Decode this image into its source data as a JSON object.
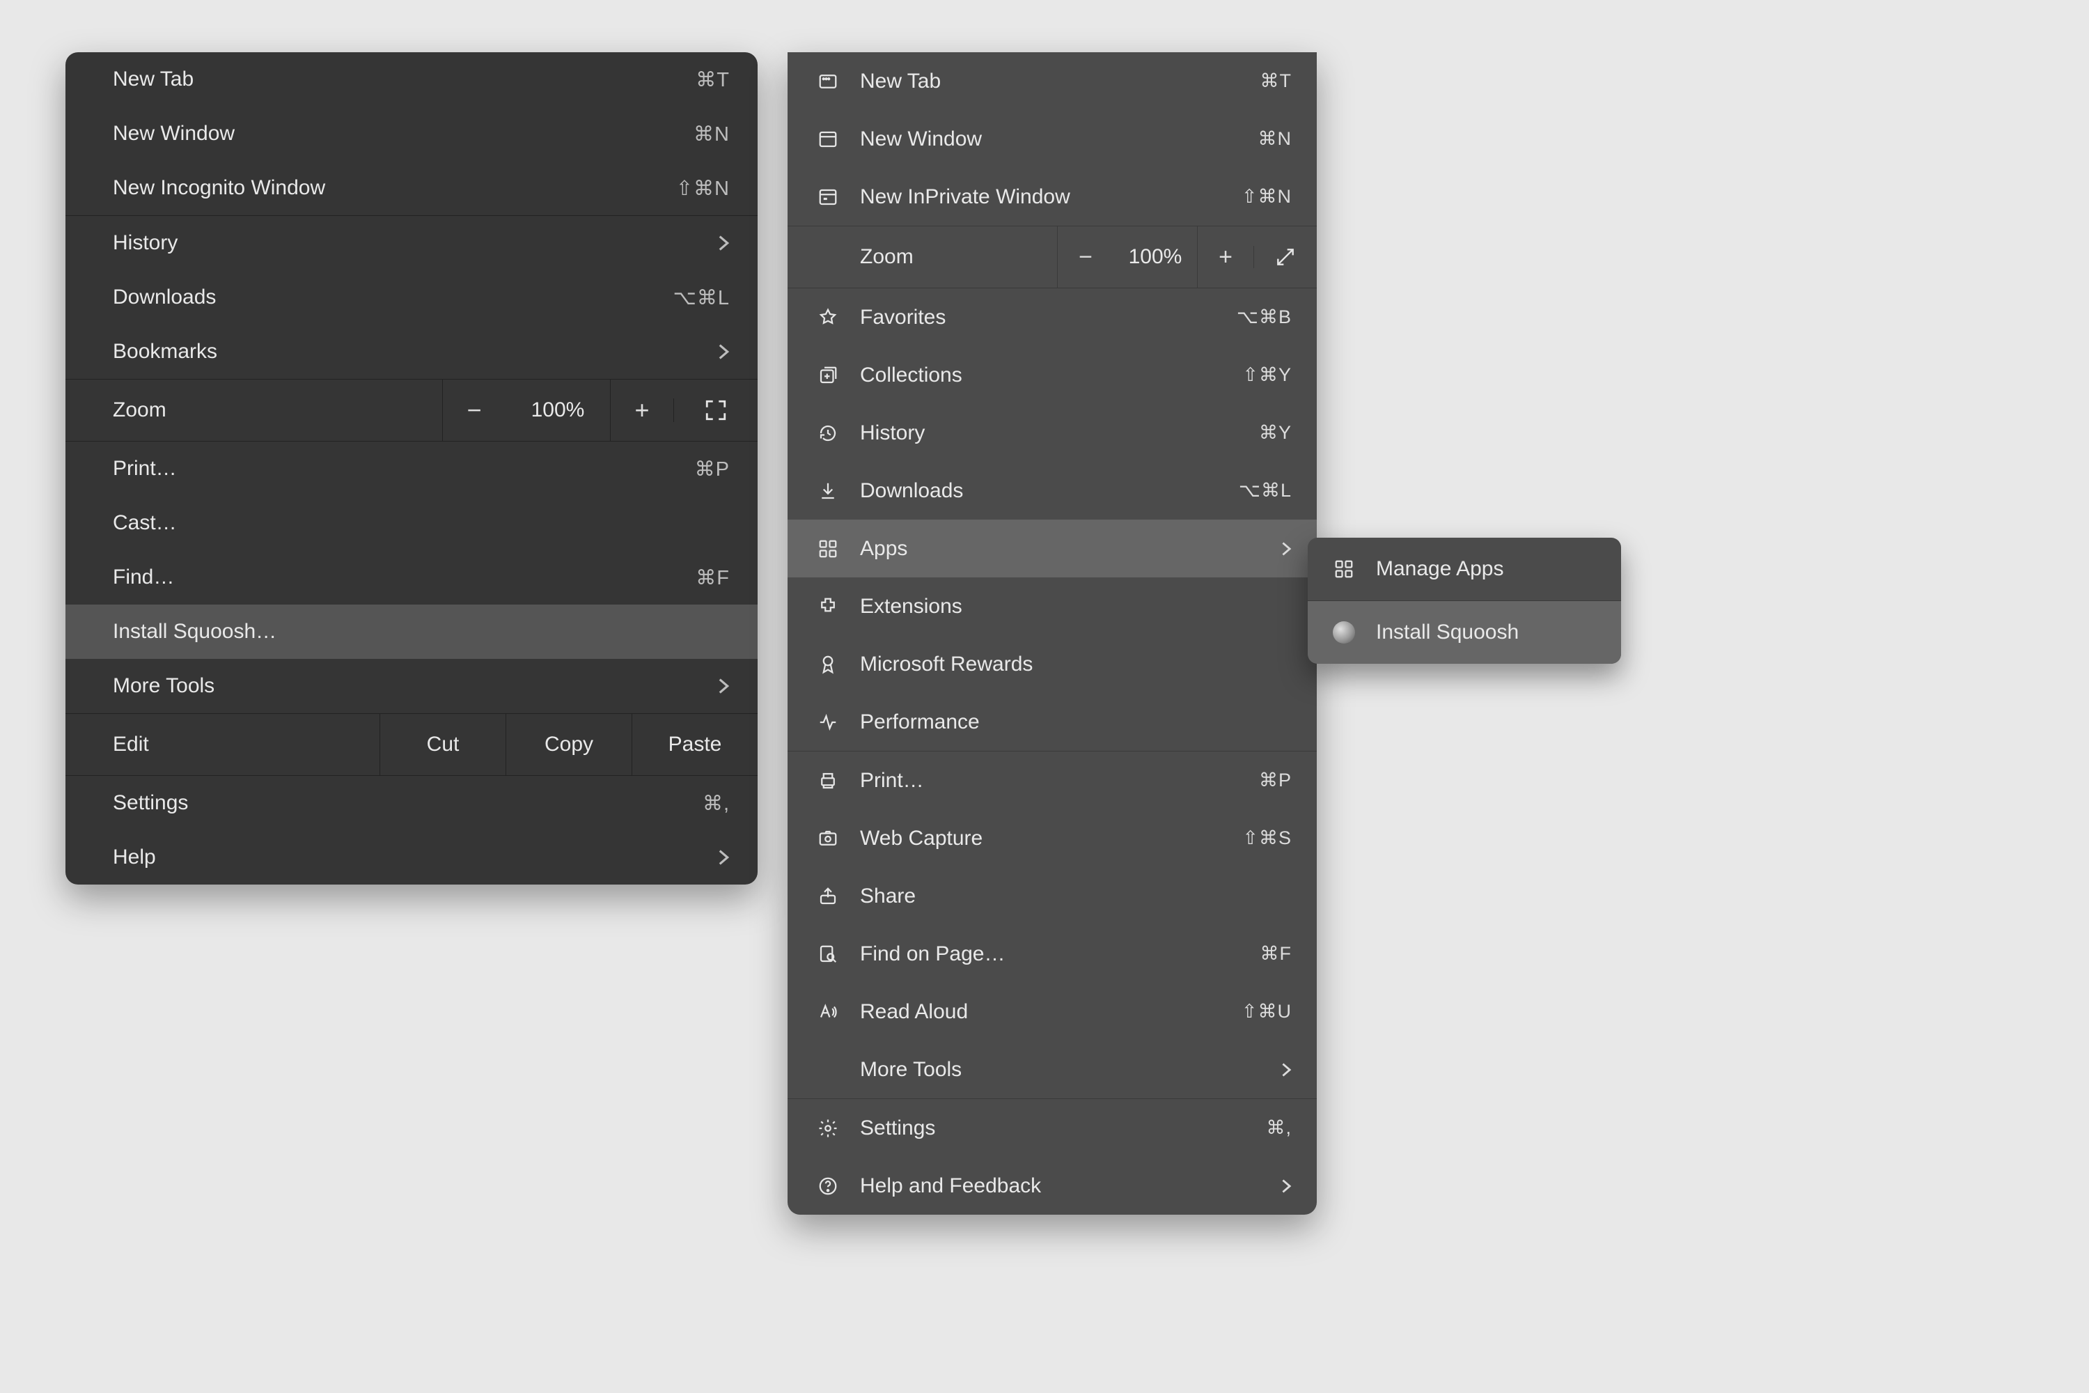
{
  "chrome_menu": {
    "new_tab": {
      "label": "New Tab",
      "shortcut": "⌘T"
    },
    "new_window": {
      "label": "New Window",
      "shortcut": "⌘N"
    },
    "new_incognito": {
      "label": "New Incognito Window",
      "shortcut": "⇧⌘N"
    },
    "history": {
      "label": "History"
    },
    "downloads": {
      "label": "Downloads",
      "shortcut": "⌥⌘L"
    },
    "bookmarks": {
      "label": "Bookmarks"
    },
    "zoom": {
      "label": "Zoom",
      "value": "100%",
      "minus": "−",
      "plus": "+"
    },
    "print": {
      "label": "Print…",
      "shortcut": "⌘P"
    },
    "cast": {
      "label": "Cast…"
    },
    "find": {
      "label": "Find…",
      "shortcut": "⌘F"
    },
    "install": {
      "label": "Install Squoosh…"
    },
    "more_tools": {
      "label": "More Tools"
    },
    "edit": {
      "label": "Edit",
      "cut": "Cut",
      "copy": "Copy",
      "paste": "Paste"
    },
    "settings": {
      "label": "Settings",
      "shortcut": "⌘,"
    },
    "help": {
      "label": "Help"
    }
  },
  "edge_menu": {
    "new_tab": {
      "label": "New Tab",
      "shortcut": "⌘T"
    },
    "new_window": {
      "label": "New Window",
      "shortcut": "⌘N"
    },
    "new_inprivate": {
      "label": "New InPrivate Window",
      "shortcut": "⇧⌘N"
    },
    "zoom": {
      "label": "Zoom",
      "value": "100%",
      "minus": "−",
      "plus": "+"
    },
    "favorites": {
      "label": "Favorites",
      "shortcut": "⌥⌘B"
    },
    "collections": {
      "label": "Collections",
      "shortcut": "⇧⌘Y"
    },
    "history": {
      "label": "History",
      "shortcut": "⌘Y"
    },
    "downloads": {
      "label": "Downloads",
      "shortcut": "⌥⌘L"
    },
    "apps": {
      "label": "Apps"
    },
    "extensions": {
      "label": "Extensions"
    },
    "rewards": {
      "label": "Microsoft Rewards"
    },
    "performance": {
      "label": "Performance"
    },
    "print": {
      "label": "Print…",
      "shortcut": "⌘P"
    },
    "web_capture": {
      "label": "Web Capture",
      "shortcut": "⇧⌘S"
    },
    "share": {
      "label": "Share"
    },
    "find": {
      "label": "Find on Page…",
      "shortcut": "⌘F"
    },
    "read_aloud": {
      "label": "Read Aloud",
      "shortcut": "⇧⌘U"
    },
    "more_tools": {
      "label": "More Tools"
    },
    "settings": {
      "label": "Settings",
      "shortcut": "⌘,"
    },
    "help": {
      "label": "Help and Feedback"
    }
  },
  "submenu": {
    "manage": {
      "label": "Manage Apps"
    },
    "install": {
      "label": "Install Squoosh"
    }
  }
}
